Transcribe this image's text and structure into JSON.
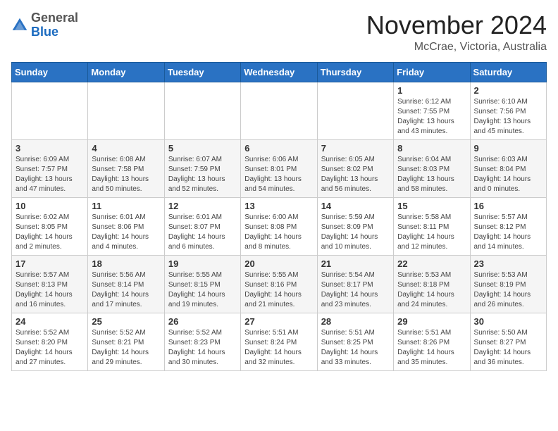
{
  "header": {
    "logo_general": "General",
    "logo_blue": "Blue",
    "month_title": "November 2024",
    "location": "McCrae, Victoria, Australia"
  },
  "days_of_week": [
    "Sunday",
    "Monday",
    "Tuesday",
    "Wednesday",
    "Thursday",
    "Friday",
    "Saturday"
  ],
  "weeks": [
    [
      {
        "day": "",
        "info": ""
      },
      {
        "day": "",
        "info": ""
      },
      {
        "day": "",
        "info": ""
      },
      {
        "day": "",
        "info": ""
      },
      {
        "day": "",
        "info": ""
      },
      {
        "day": "1",
        "info": "Sunrise: 6:12 AM\nSunset: 7:55 PM\nDaylight: 13 hours\nand 43 minutes."
      },
      {
        "day": "2",
        "info": "Sunrise: 6:10 AM\nSunset: 7:56 PM\nDaylight: 13 hours\nand 45 minutes."
      }
    ],
    [
      {
        "day": "3",
        "info": "Sunrise: 6:09 AM\nSunset: 7:57 PM\nDaylight: 13 hours\nand 47 minutes."
      },
      {
        "day": "4",
        "info": "Sunrise: 6:08 AM\nSunset: 7:58 PM\nDaylight: 13 hours\nand 50 minutes."
      },
      {
        "day": "5",
        "info": "Sunrise: 6:07 AM\nSunset: 7:59 PM\nDaylight: 13 hours\nand 52 minutes."
      },
      {
        "day": "6",
        "info": "Sunrise: 6:06 AM\nSunset: 8:01 PM\nDaylight: 13 hours\nand 54 minutes."
      },
      {
        "day": "7",
        "info": "Sunrise: 6:05 AM\nSunset: 8:02 PM\nDaylight: 13 hours\nand 56 minutes."
      },
      {
        "day": "8",
        "info": "Sunrise: 6:04 AM\nSunset: 8:03 PM\nDaylight: 13 hours\nand 58 minutes."
      },
      {
        "day": "9",
        "info": "Sunrise: 6:03 AM\nSunset: 8:04 PM\nDaylight: 14 hours\nand 0 minutes."
      }
    ],
    [
      {
        "day": "10",
        "info": "Sunrise: 6:02 AM\nSunset: 8:05 PM\nDaylight: 14 hours\nand 2 minutes."
      },
      {
        "day": "11",
        "info": "Sunrise: 6:01 AM\nSunset: 8:06 PM\nDaylight: 14 hours\nand 4 minutes."
      },
      {
        "day": "12",
        "info": "Sunrise: 6:01 AM\nSunset: 8:07 PM\nDaylight: 14 hours\nand 6 minutes."
      },
      {
        "day": "13",
        "info": "Sunrise: 6:00 AM\nSunset: 8:08 PM\nDaylight: 14 hours\nand 8 minutes."
      },
      {
        "day": "14",
        "info": "Sunrise: 5:59 AM\nSunset: 8:09 PM\nDaylight: 14 hours\nand 10 minutes."
      },
      {
        "day": "15",
        "info": "Sunrise: 5:58 AM\nSunset: 8:11 PM\nDaylight: 14 hours\nand 12 minutes."
      },
      {
        "day": "16",
        "info": "Sunrise: 5:57 AM\nSunset: 8:12 PM\nDaylight: 14 hours\nand 14 minutes."
      }
    ],
    [
      {
        "day": "17",
        "info": "Sunrise: 5:57 AM\nSunset: 8:13 PM\nDaylight: 14 hours\nand 16 minutes."
      },
      {
        "day": "18",
        "info": "Sunrise: 5:56 AM\nSunset: 8:14 PM\nDaylight: 14 hours\nand 17 minutes."
      },
      {
        "day": "19",
        "info": "Sunrise: 5:55 AM\nSunset: 8:15 PM\nDaylight: 14 hours\nand 19 minutes."
      },
      {
        "day": "20",
        "info": "Sunrise: 5:55 AM\nSunset: 8:16 PM\nDaylight: 14 hours\nand 21 minutes."
      },
      {
        "day": "21",
        "info": "Sunrise: 5:54 AM\nSunset: 8:17 PM\nDaylight: 14 hours\nand 23 minutes."
      },
      {
        "day": "22",
        "info": "Sunrise: 5:53 AM\nSunset: 8:18 PM\nDaylight: 14 hours\nand 24 minutes."
      },
      {
        "day": "23",
        "info": "Sunrise: 5:53 AM\nSunset: 8:19 PM\nDaylight: 14 hours\nand 26 minutes."
      }
    ],
    [
      {
        "day": "24",
        "info": "Sunrise: 5:52 AM\nSunset: 8:20 PM\nDaylight: 14 hours\nand 27 minutes."
      },
      {
        "day": "25",
        "info": "Sunrise: 5:52 AM\nSunset: 8:21 PM\nDaylight: 14 hours\nand 29 minutes."
      },
      {
        "day": "26",
        "info": "Sunrise: 5:52 AM\nSunset: 8:23 PM\nDaylight: 14 hours\nand 30 minutes."
      },
      {
        "day": "27",
        "info": "Sunrise: 5:51 AM\nSunset: 8:24 PM\nDaylight: 14 hours\nand 32 minutes."
      },
      {
        "day": "28",
        "info": "Sunrise: 5:51 AM\nSunset: 8:25 PM\nDaylight: 14 hours\nand 33 minutes."
      },
      {
        "day": "29",
        "info": "Sunrise: 5:51 AM\nSunset: 8:26 PM\nDaylight: 14 hours\nand 35 minutes."
      },
      {
        "day": "30",
        "info": "Sunrise: 5:50 AM\nSunset: 8:27 PM\nDaylight: 14 hours\nand 36 minutes."
      }
    ]
  ]
}
